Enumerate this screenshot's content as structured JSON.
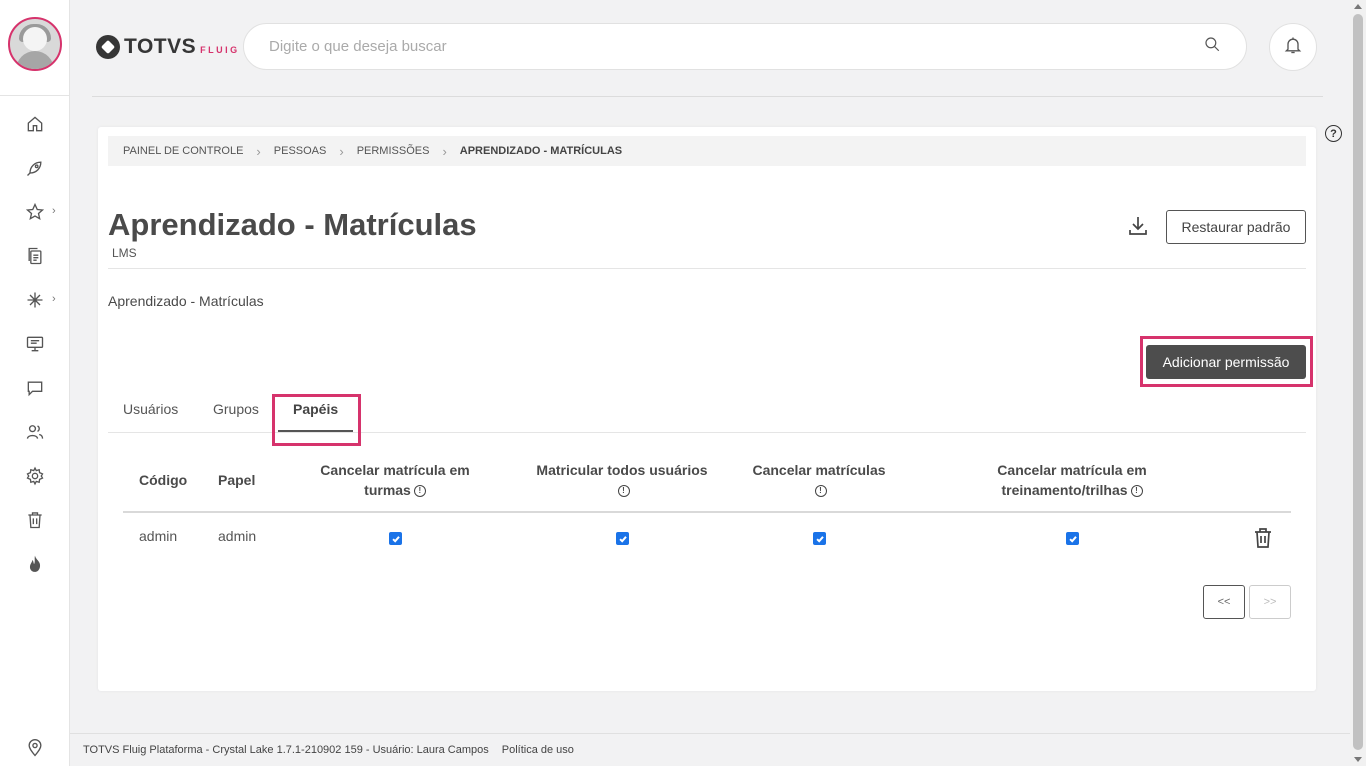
{
  "brand": {
    "logo_word": "TOTVS",
    "logo_sub": "FLUIG",
    "accent": "#d6336c"
  },
  "search": {
    "placeholder": "Digite o que deseja buscar"
  },
  "sidebar": {
    "items": [
      {
        "icon": "home-icon"
      },
      {
        "icon": "rocket-icon"
      },
      {
        "icon": "star-icon",
        "has_submenu": true
      },
      {
        "icon": "documents-icon"
      },
      {
        "icon": "workflow-icon",
        "has_submenu": true
      },
      {
        "icon": "presentation-icon"
      },
      {
        "icon": "chat-icon"
      },
      {
        "icon": "people-icon"
      },
      {
        "icon": "gear-icon"
      },
      {
        "icon": "trash-icon"
      },
      {
        "icon": "fire-icon"
      },
      {
        "icon": "location-icon"
      }
    ]
  },
  "breadcrumb": {
    "items": [
      "PAINEL DE CONTROLE",
      "PESSOAS",
      "PERMISSÕES"
    ],
    "current": "APRENDIZADO - MATRÍCULAS"
  },
  "page": {
    "title": "Aprendizado - Matrículas",
    "subtitle": "LMS",
    "description": "Aprendizado - Matrículas",
    "restore_label": "Restaurar padrão",
    "add_label": "Adicionar permissão"
  },
  "tabs": [
    {
      "label": "Usuários",
      "active": false
    },
    {
      "label": "Grupos",
      "active": false
    },
    {
      "label": "Papéis",
      "active": true
    }
  ],
  "table": {
    "columns": [
      "Código",
      "Papel",
      "Cancelar matrícula em turmas",
      "Matricular todos usuários",
      "Cancelar matrículas",
      "Cancelar matrícula em treinamento/trilhas"
    ],
    "header_lines": {
      "c3_l1": "Cancelar matrícula em",
      "c3_l2": "turmas",
      "c4": "Matricular todos usuários",
      "c5": "Cancelar matrículas",
      "c6_l1": "Cancelar matrícula em",
      "c6_l2": "treinamento/trilhas"
    },
    "rows": [
      {
        "codigo": "admin",
        "papel": "admin",
        "permissions": [
          true,
          true,
          true,
          true
        ]
      }
    ]
  },
  "pager": {
    "prev": "<<",
    "next": ">>"
  },
  "footer": {
    "text": "TOTVS Fluig Plataforma - Crystal Lake 1.7.1-210902 159 - Usuário: Laura Campos",
    "link": "Política de uso"
  }
}
